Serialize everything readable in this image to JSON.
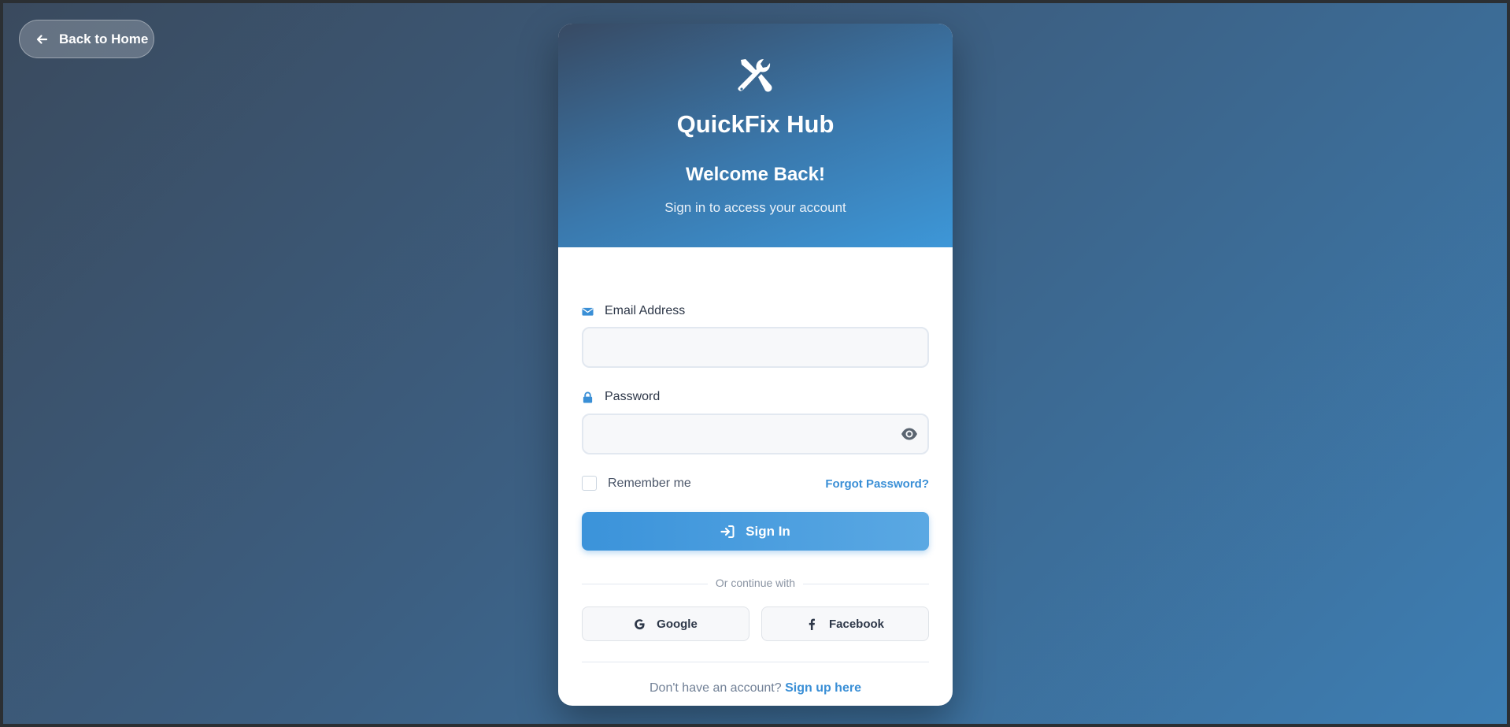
{
  "nav": {
    "back_label": "Back to Home"
  },
  "header": {
    "brand": "QuickFix Hub",
    "welcome": "Welcome Back!",
    "subtitle": "Sign in to access your account"
  },
  "form": {
    "email_label": "Email Address",
    "email_value": "",
    "password_label": "Password",
    "password_value": "",
    "remember_label": "Remember me",
    "remember_checked": false,
    "forgot_label": "Forgot Password?",
    "signin_label": "Sign In",
    "divider_text": "Or continue with"
  },
  "social": {
    "google_label": "Google",
    "facebook_label": "Facebook"
  },
  "footer": {
    "prompt": "Don't have an account?",
    "signup_label": "Sign up here"
  },
  "colors": {
    "accent": "#3a8fd6",
    "header_start": "#384a63",
    "header_end": "#3d97d8"
  },
  "icons": [
    "arrow-left-icon",
    "tools-icon",
    "envelope-icon",
    "lock-icon",
    "eye-icon",
    "sign-in-icon",
    "google-icon",
    "facebook-icon"
  ]
}
